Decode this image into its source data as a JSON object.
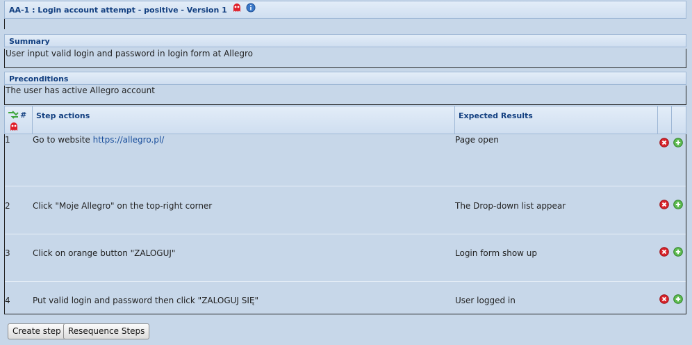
{
  "test_case": {
    "title": "AA-1 : Login account attempt - positive - Version 1"
  },
  "summary": {
    "heading": "Summary",
    "text": "User input valid login and password in login form at Allegro"
  },
  "preconditions": {
    "heading": "Preconditions",
    "text": "The user has active Allegro account"
  },
  "steps_table": {
    "hash_label": "#",
    "col_actions": "Step actions",
    "col_results": "Expected Results",
    "rows": [
      {
        "num": "1",
        "action": "Go to website ",
        "link": "https://allegro.pl/",
        "result": "Page open"
      },
      {
        "num": "2",
        "action": "Click \"Moje Allegro\" on the top-right corner",
        "link": "",
        "result": "The Drop-down list appear"
      },
      {
        "num": "3",
        "action": "Click on orange button \"ZALOGUJ\"",
        "link": "",
        "result": "Login form show up"
      },
      {
        "num": "4",
        "action": "Put valid login and password then click \"ZALOGUJ SIĘ\"",
        "link": "",
        "result": "User logged in"
      }
    ]
  },
  "buttons": {
    "create_step": "Create step",
    "resequence": "Resequence Steps"
  },
  "icons": {
    "ghost_color": "#e0202a",
    "info_color": "#3a78c8",
    "delete_color": "#d8232a",
    "add_color": "#3fa63f"
  }
}
